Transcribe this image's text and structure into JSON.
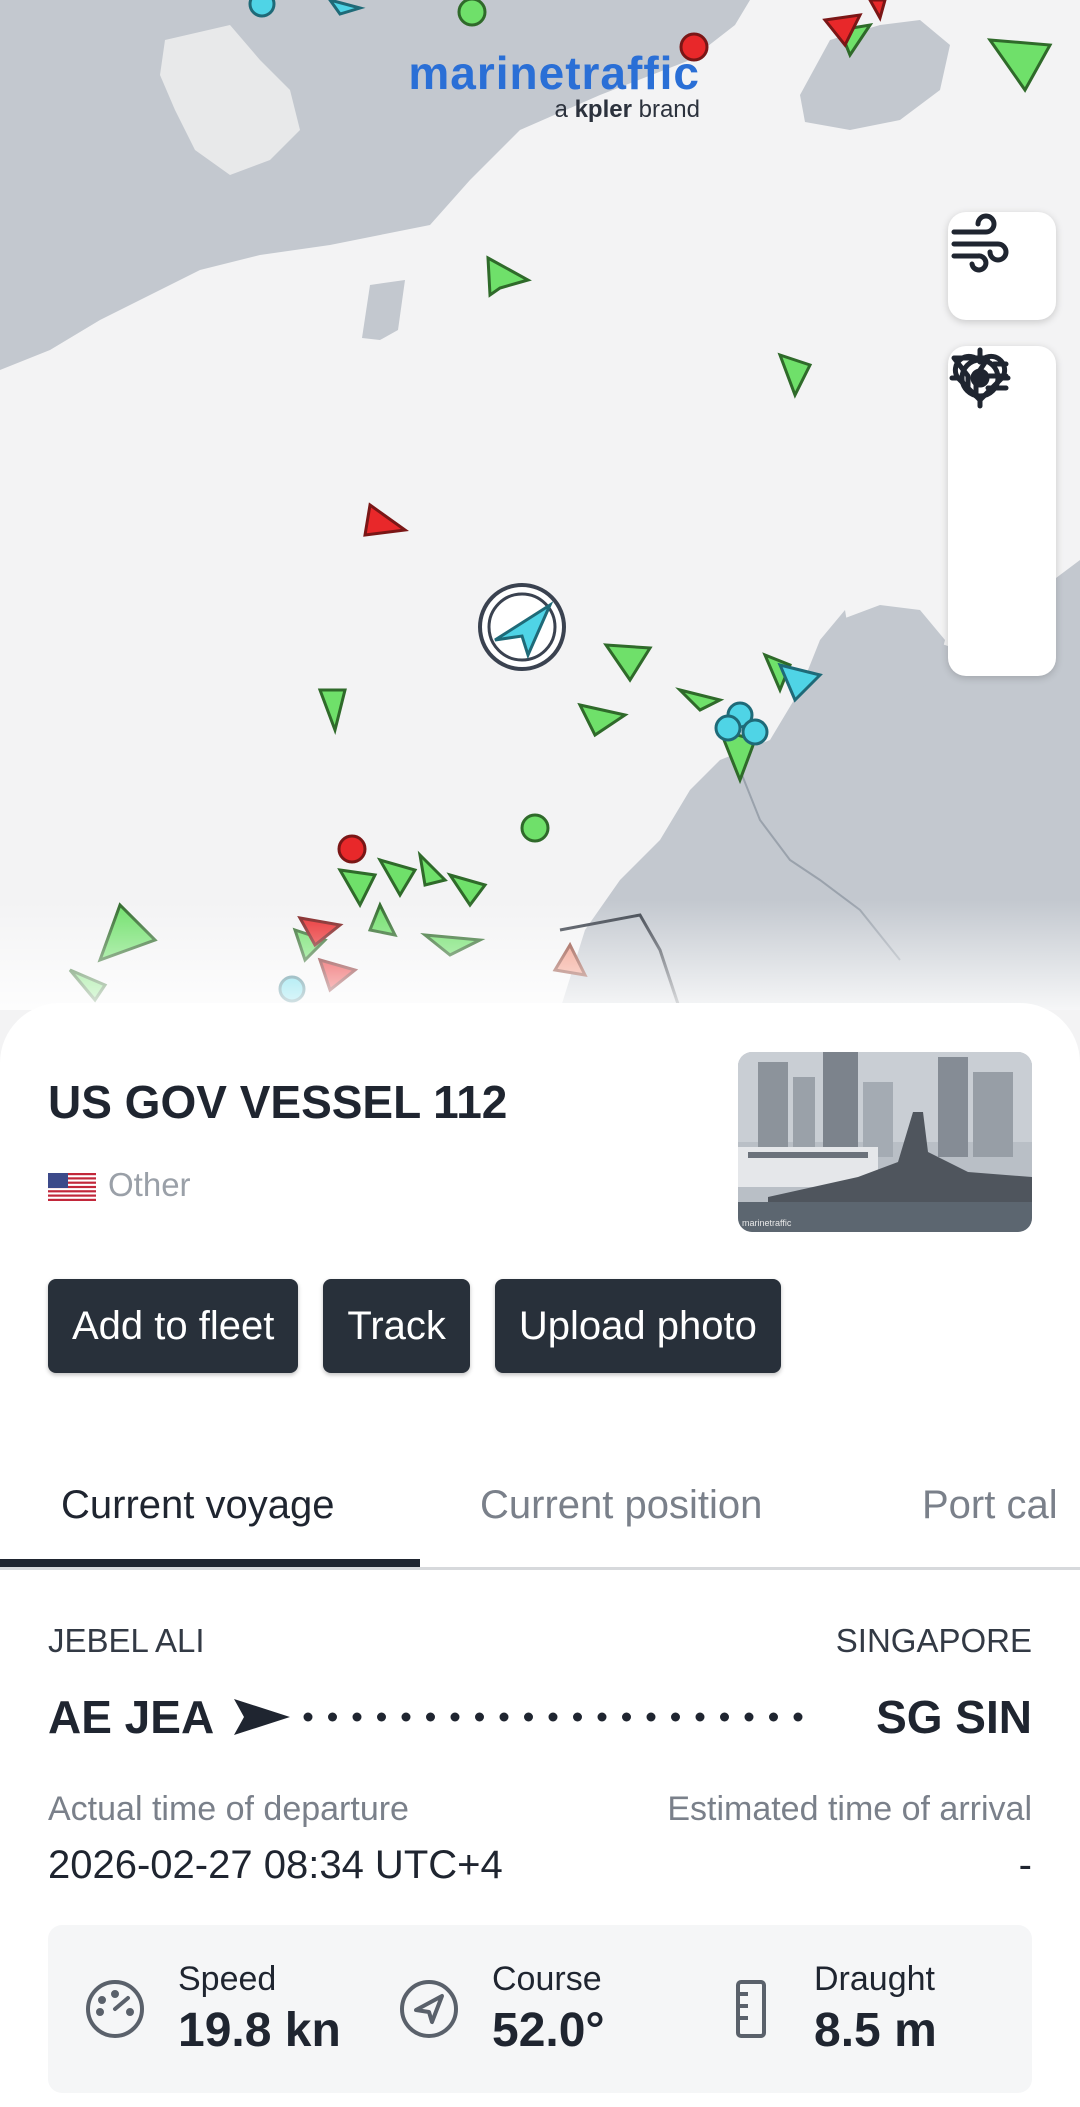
{
  "map": {
    "brand_name": "marinetraffic",
    "brand_tagline_prefix": "a",
    "brand_tagline_strong": "kpler",
    "brand_tagline_suffix": "brand",
    "controls": [
      "wind-icon",
      "heart-icon",
      "filter-icon",
      "locate-icon"
    ]
  },
  "vessel": {
    "name": "US GOV VESSEL 112",
    "type": "Other",
    "flag": "us-flag-icon",
    "photo_watermark": "marinetraffic"
  },
  "actions": {
    "add_to_fleet": "Add to fleet",
    "track": "Track",
    "upload_photo": "Upload photo"
  },
  "tabs": [
    "Current voyage",
    "Current position",
    "Port cal"
  ],
  "voyage": {
    "origin_name": "JEBEL ALI",
    "origin_code": "AE JEA",
    "destination_name": "SINGAPORE",
    "destination_code": "SG SIN",
    "atd_label": "Actual time of departure",
    "atd_value": "2026-02-27 08:34 UTC+4",
    "eta_label": "Estimated time of arrival",
    "eta_value": "-"
  },
  "stats": {
    "speed_label": "Speed",
    "speed_value": "19.8 kn",
    "course_label": "Course",
    "course_value": "52.0°",
    "draught_label": "Draught",
    "draught_value": "8.5 m"
  },
  "colors": {
    "land": "#c3c8cf",
    "sea": "#f3f3f4",
    "green_vessel": "#6fe06a",
    "red_vessel": "#e8282a",
    "cyan_vessel": "#4fd4e6",
    "dark": "#28303a",
    "brand_blue": "#2a6fd6"
  }
}
